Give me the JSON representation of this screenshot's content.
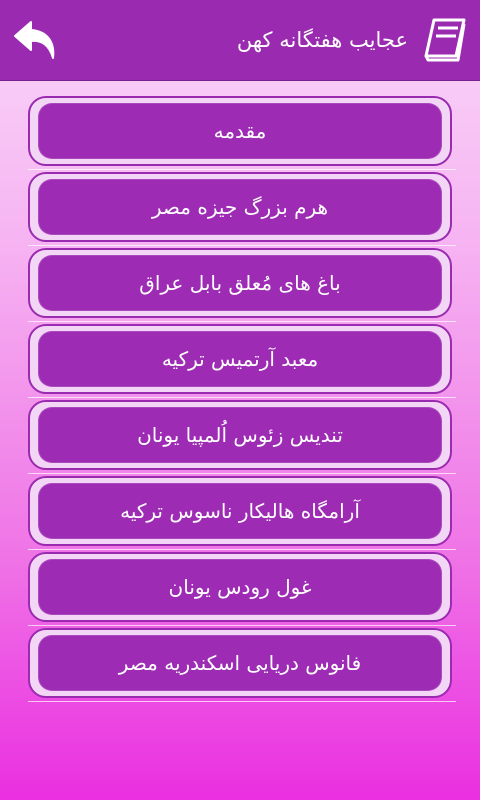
{
  "header": {
    "title": "عجایب هفتگانه کهن",
    "back_icon": "back-arrow-icon",
    "book_icon": "book-icon"
  },
  "items": [
    {
      "label": "مقدمه"
    },
    {
      "label": "هرم بزرگ جیزه مصر"
    },
    {
      "label": "باغ های مُعلق بابل عراق"
    },
    {
      "label": "معبد آرتمیس ترکیه"
    },
    {
      "label": "تندیس زئوس اُلمپیا یونان"
    },
    {
      "label": "آرامگاه هالیکار ناسوس ترکیه"
    },
    {
      "label": "غول رودس یونان"
    },
    {
      "label": "فانوس دریایی اسکندریه مصر"
    }
  ],
  "colors": {
    "header": "#9a2bb0",
    "button": "#9d2bb4",
    "text": "#ffffff"
  }
}
